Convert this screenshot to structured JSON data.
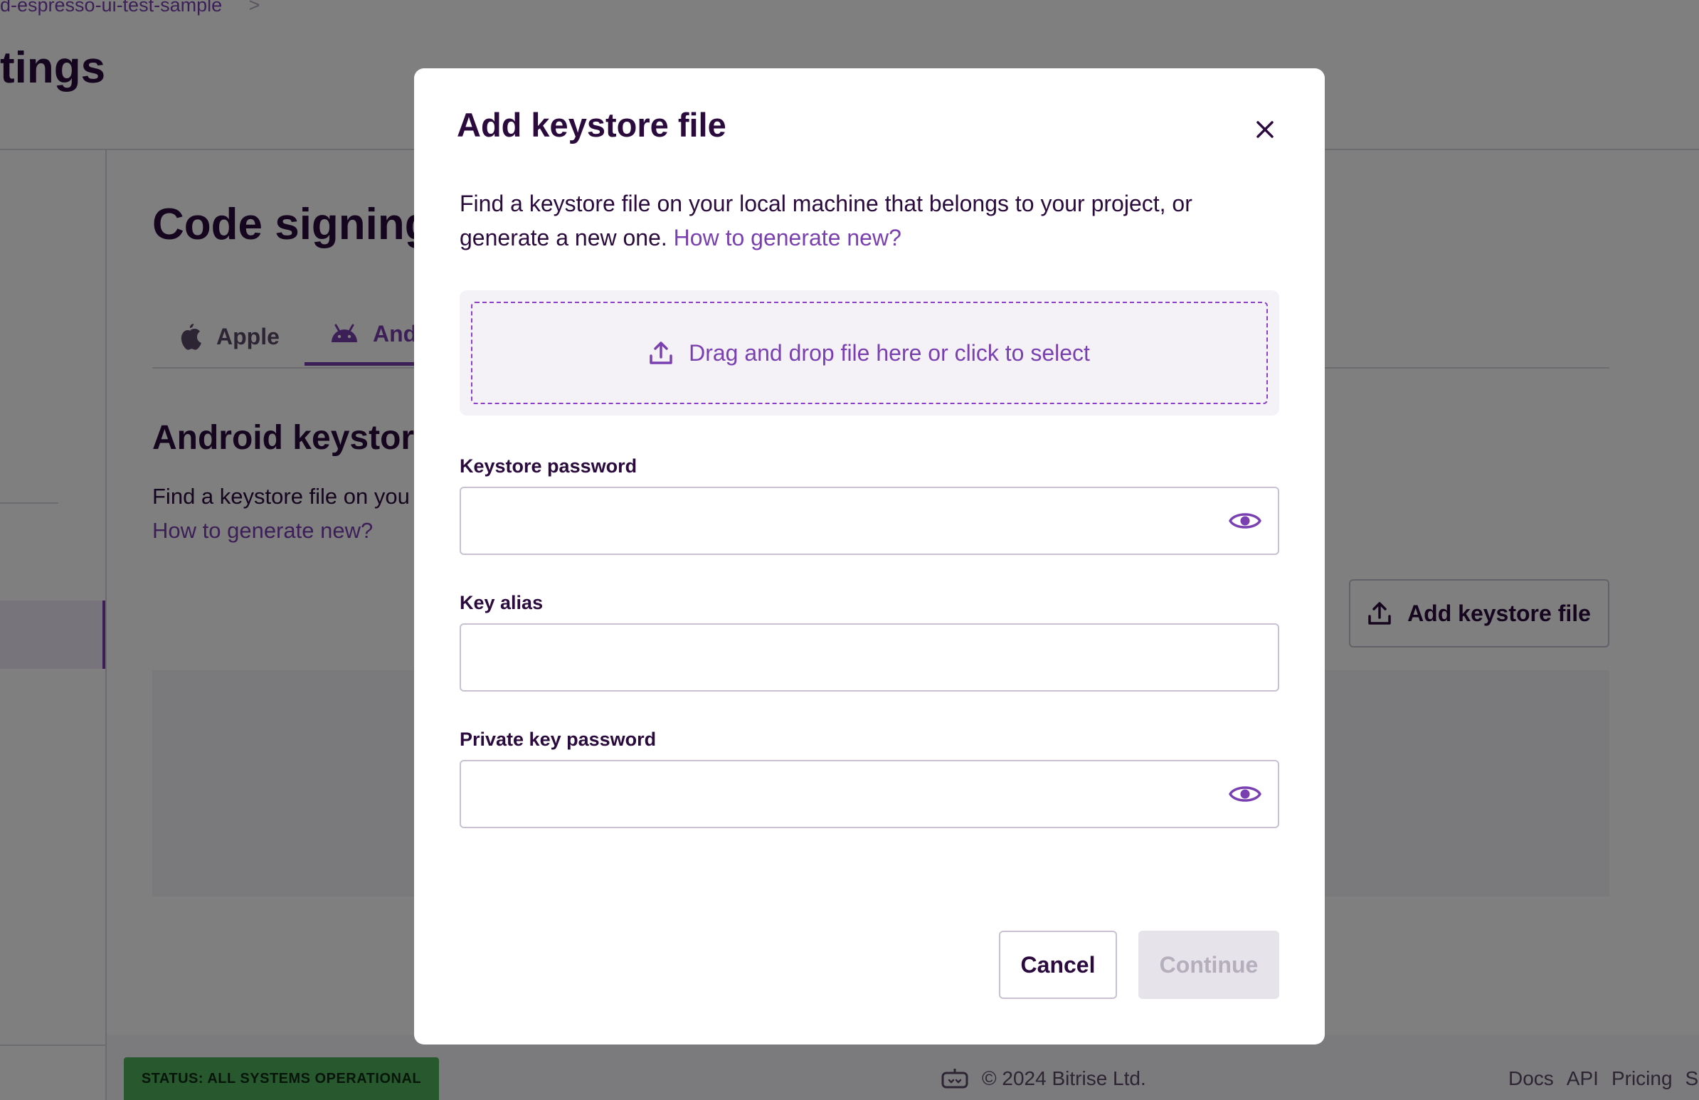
{
  "breadcrumb": {
    "project": "d-espresso-ui-test-sample",
    "separator": ">"
  },
  "page": {
    "title": "tings"
  },
  "section": {
    "title": "Code signing",
    "tabs": [
      {
        "label": "Apple",
        "icon": "apple-icon"
      },
      {
        "label": "And",
        "icon": "android-icon"
      }
    ],
    "subtitle": "Android keystore",
    "description": "Find a keystore file on you",
    "link": "How to generate new?",
    "add_button": "Add keystore file"
  },
  "footer": {
    "status": "STATUS: ALL SYSTEMS OPERATIONAL",
    "copyright": "© 2024 Bitrise Ltd.",
    "links": [
      "Docs",
      "API",
      "Pricing",
      "Se"
    ]
  },
  "modal": {
    "title": "Add keystore file",
    "description": "Find a keystore file on your local machine that belongs to your project, or generate a new one.",
    "link": "How to generate new?",
    "dropzone": "Drag and drop file here or click to select",
    "fields": {
      "keystore_password": {
        "label": "Keystore password",
        "value": ""
      },
      "key_alias": {
        "label": "Key alias",
        "value": ""
      },
      "private_key_password": {
        "label": "Private key password",
        "value": ""
      }
    },
    "cancel": "Cancel",
    "continue": "Continue"
  },
  "colors": {
    "accent": "#7a3fb0",
    "text": "#2b0a3d",
    "status_green": "#51b25d"
  }
}
